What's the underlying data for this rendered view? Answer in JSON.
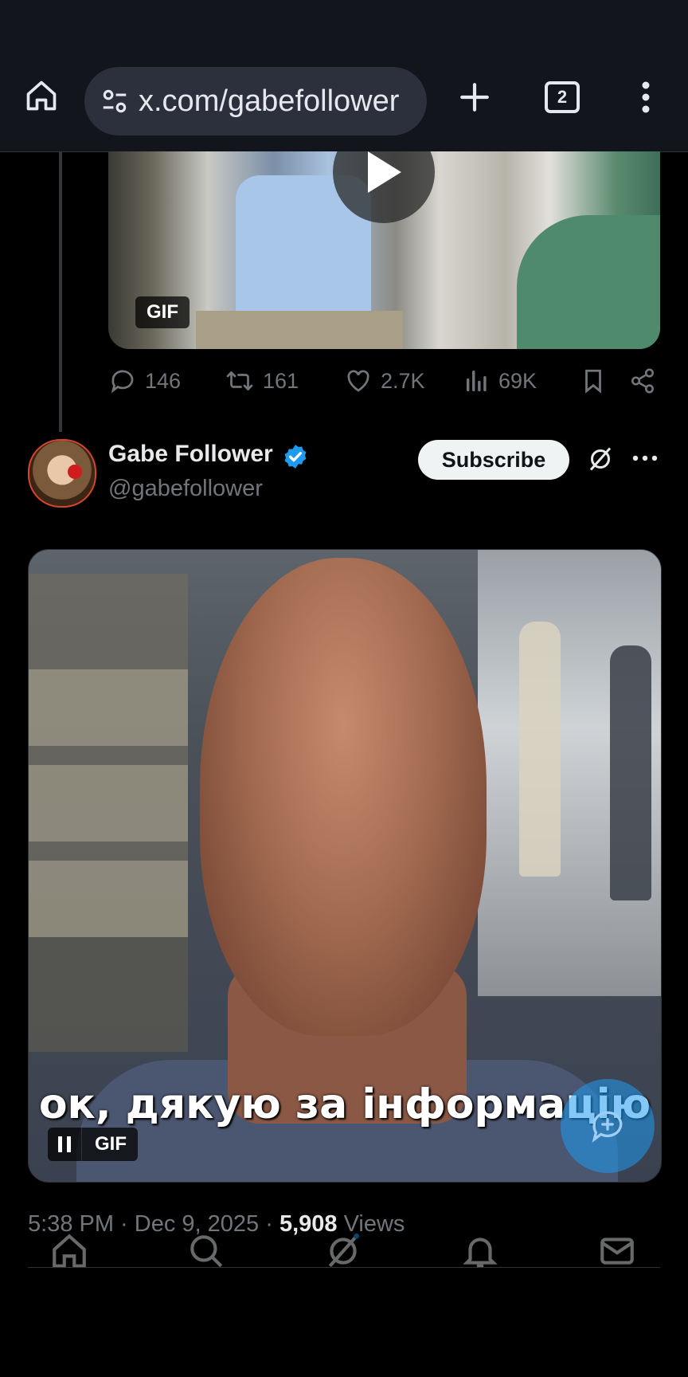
{
  "browser": {
    "url": "x.com/gabefollower",
    "tab_count": "2"
  },
  "prev_tweet": {
    "media_badge": "GIF",
    "stats": {
      "replies": "146",
      "reposts": "161",
      "likes": "2.7K",
      "views": "69K"
    }
  },
  "tweet": {
    "author_name": "Gabe Follower",
    "handle": "@gabefollower",
    "subscribe_label": "Subscribe",
    "media": {
      "caption": "ок, дякую за інформацію",
      "badge": "GIF"
    },
    "time": "5:38 PM",
    "date": "Dec 9, 2025",
    "views_count": "5,908",
    "views_label": "Views"
  },
  "colors": {
    "verified": "#1d9bf0",
    "accent": "#1d9bf0",
    "background": "#000000",
    "browser_chrome": "#13151c"
  },
  "icons": [
    "home-icon",
    "site-settings-icon",
    "new-tab-icon",
    "tabs-icon",
    "menu-icon",
    "reply-icon",
    "repost-icon",
    "like-icon",
    "views-icon",
    "bookmark-icon",
    "share-icon",
    "grok-icon",
    "more-icon",
    "pause-icon",
    "compose-icon",
    "search-icon",
    "notifications-icon",
    "messages-icon"
  ]
}
